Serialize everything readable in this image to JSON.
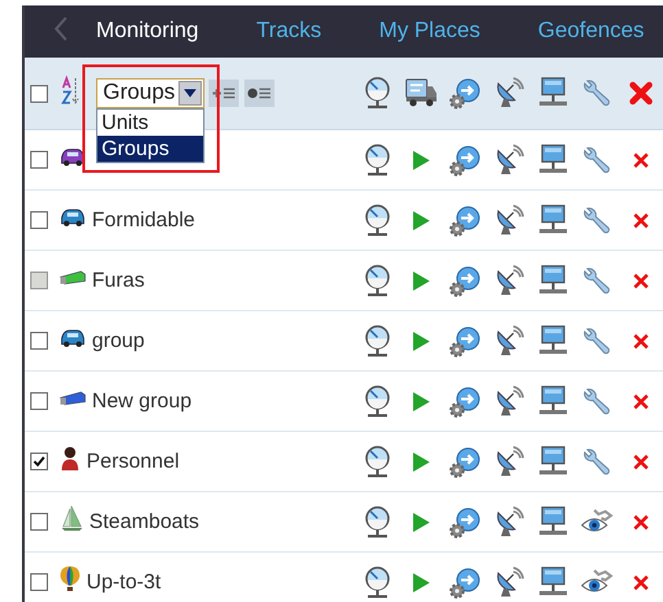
{
  "tabs": [
    {
      "label": "Monitoring",
      "selected": true
    },
    {
      "label": "Tracks",
      "selected": false
    },
    {
      "label": "My Places",
      "selected": false
    },
    {
      "label": "Geofences",
      "selected": false
    }
  ],
  "header": {
    "checked": false,
    "highlighted": true,
    "group_by": {
      "value": "Groups",
      "open": true,
      "options": [
        {
          "label": "Units",
          "selected": false
        },
        {
          "label": "Groups",
          "selected": true
        }
      ]
    }
  },
  "rows": [
    {
      "checked": false,
      "disabled": false,
      "kind": "car",
      "color": "#8a3fc0",
      "readonly": false
    },
    {
      "name": "Formidable",
      "checked": false,
      "disabled": false,
      "kind": "car",
      "color": "#2a86c8",
      "readonly": false
    },
    {
      "name": "Furas",
      "checked": false,
      "disabled": true,
      "kind": "truck",
      "color": "#3fbf3f",
      "readonly": false
    },
    {
      "name": "group",
      "checked": false,
      "disabled": false,
      "kind": "car",
      "color": "#2a86c8",
      "readonly": false
    },
    {
      "name": "New group",
      "checked": false,
      "disabled": false,
      "kind": "truck",
      "color": "#2f5fd8",
      "readonly": false
    },
    {
      "name": "Personnel",
      "checked": true,
      "disabled": false,
      "kind": "person",
      "color": "#c0282a",
      "readonly": false
    },
    {
      "name": "Steamboats",
      "checked": false,
      "disabled": false,
      "kind": "boat",
      "color": "#7fbf7f",
      "readonly": true
    },
    {
      "name": "Up-to-3t",
      "checked": false,
      "disabled": false,
      "kind": "balloon",
      "color": "#e0a020",
      "readonly": true
    }
  ]
}
